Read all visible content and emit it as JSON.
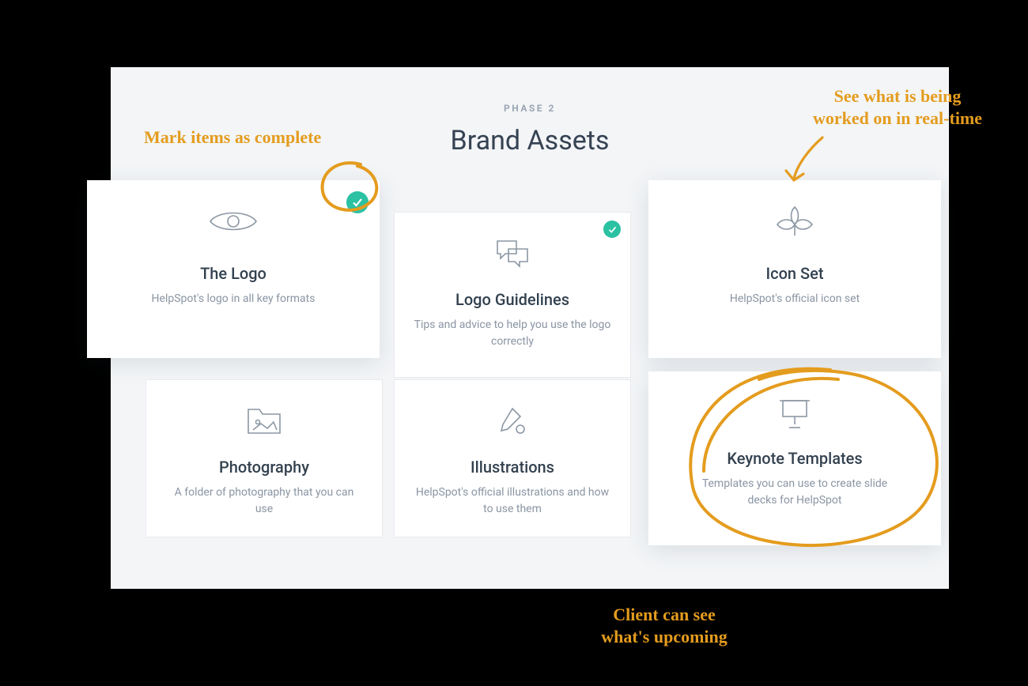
{
  "phase_label": "PHASE 2",
  "page_title": "Brand Assets",
  "colors": {
    "accent": "#2bc1a3",
    "annotation": "#e49c1e",
    "bg": "#f3f5f7"
  },
  "cards": [
    {
      "title": "The Logo",
      "desc": "HelpSpot's logo in all key formats",
      "icon": "eye-icon",
      "completed": true,
      "raised": true
    },
    {
      "title": "Logo Guidelines",
      "desc": "Tips and advice to help you use the logo correctly",
      "icon": "chat-icon",
      "completed": true,
      "raised": false
    },
    {
      "title": "Icon Set",
      "desc": "HelpSpot's official icon set",
      "icon": "leaf-icon",
      "completed": false,
      "raised": true
    },
    {
      "title": "Photography",
      "desc": "A folder of photography that you can use",
      "icon": "image-folder-icon",
      "completed": false,
      "raised": false
    },
    {
      "title": "Illustrations",
      "desc": "HelpSpot's official illustrations and how to use them",
      "icon": "paint-icon",
      "completed": false,
      "raised": false
    },
    {
      "title": "Keynote Templates",
      "desc": "Templates you can use to create slide decks for HelpSpot",
      "icon": "presentation-icon",
      "completed": false,
      "raised": true
    }
  ],
  "annotations": {
    "mark_complete": "Mark items as complete",
    "realtime": "See what is being\nworked on in real-time",
    "upcoming": "Client can see\nwhat's upcoming"
  }
}
